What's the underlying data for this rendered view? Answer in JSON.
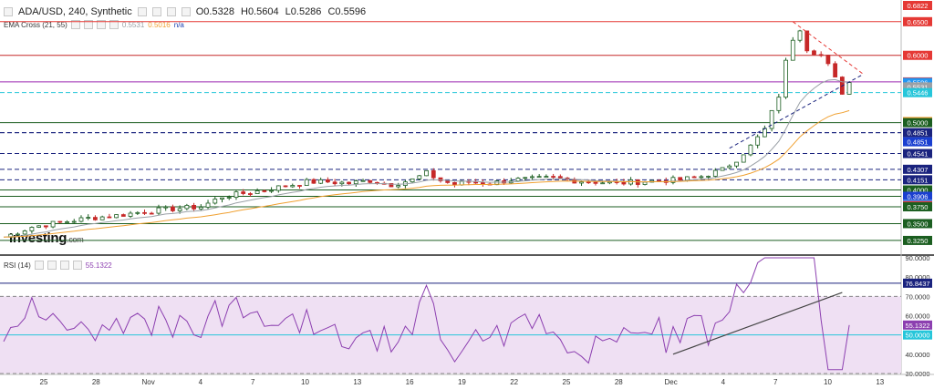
{
  "header": {
    "symbol": "ADA/USD, 240, Synthetic",
    "ohlc": [
      "O0.5328",
      "H0.5604",
      "L0.5286",
      "C0.5596"
    ]
  },
  "indicator": {
    "label": "EMA Cross (21, 55)",
    "value_fast": "0.5531",
    "value_slow": "0.5016",
    "value_na": "n/a"
  },
  "rsi": {
    "label": "RSI (14)",
    "value": "55.1322"
  },
  "logo": {
    "text": "Investing",
    "suffix": ".com"
  },
  "colors": {
    "red_level": "#e53935",
    "purple_level": "#9c27b0",
    "cyan_level": "#26c6da",
    "navy_level": "#1a237e",
    "green_level": "#1b5e20",
    "candle_up": "#1b5e20",
    "candle_down": "#c62828",
    "ema_fast": "#9aa0a6",
    "ema_slow": "#f0a030",
    "rsi_line": "#8c3fb0",
    "rsi_band": "#efe0f3"
  },
  "chart_data": [
    {
      "type": "candlestick",
      "title": "ADA/USD, 240, Synthetic",
      "ylim": [
        0.31,
        0.6822
      ],
      "x_tick_labels": [
        "25",
        "28",
        "Nov",
        "4",
        "7",
        "10",
        "13",
        "16",
        "19",
        "22",
        "25",
        "28",
        "Dec",
        "4",
        "7",
        "10",
        "13"
      ],
      "price_labels": [
        {
          "text": "0.6822",
          "value": 0.6822,
          "color": "#e53935"
        },
        {
          "text": "0.6500",
          "value": 0.65,
          "color": "#e53935"
        },
        {
          "text": "0.6000",
          "value": 0.6,
          "color": "#e53935"
        },
        {
          "text": "0.5605",
          "value": 0.5605,
          "color": "#e53935"
        },
        {
          "text": "0.5596",
          "value": 0.5596,
          "color": "#2196f3"
        },
        {
          "text": "0.5531",
          "value": 0.5531,
          "color": "#9aa0a6"
        },
        {
          "text": "0.5446",
          "value": 0.5446,
          "color": "#26c6da"
        },
        {
          "text": "0.5016",
          "value": 0.5016,
          "color": "#f0a030"
        },
        {
          "text": "0.5000",
          "value": 0.5,
          "color": "#1b5e20"
        },
        {
          "text": "0.4851",
          "value": 0.4851,
          "color": "#1a237e"
        },
        {
          "text": "0.4851",
          "value": 0.4851,
          "color": "#1a3fd0"
        },
        {
          "text": "0.4541",
          "value": 0.4541,
          "color": "#1a237e"
        },
        {
          "text": "0.4307",
          "value": 0.4307,
          "color": "#1a237e"
        },
        {
          "text": "0.4151",
          "value": 0.4151,
          "color": "#1a237e"
        },
        {
          "text": "0.4000",
          "value": 0.4,
          "color": "#1b5e20"
        },
        {
          "text": "0.3906",
          "value": 0.3906,
          "color": "#1a3fd0"
        },
        {
          "text": "0.3792",
          "value": 0.3792,
          "color": "#4a7fe0"
        },
        {
          "text": "0.3765",
          "value": 0.3765,
          "color": "#e53935"
        },
        {
          "text": "0.3750",
          "value": 0.375,
          "color": "#1b5e20"
        },
        {
          "text": "0.3500",
          "value": 0.35,
          "color": "#1b5e20"
        },
        {
          "text": "0.3250",
          "value": 0.325,
          "color": "#1b5e20"
        }
      ],
      "levels": [
        {
          "value": 0.65,
          "color": "#e53935",
          "style": "solid"
        },
        {
          "value": 0.6,
          "color": "#c62828",
          "style": "solid"
        },
        {
          "value": 0.5605,
          "color": "#9c27b0",
          "style": "solid"
        },
        {
          "value": 0.5446,
          "color": "#26c6da",
          "style": "dashed"
        },
        {
          "value": 0.5,
          "color": "#1b5e20",
          "style": "solid"
        },
        {
          "value": 0.4851,
          "color": "#1a237e",
          "style": "dashed"
        },
        {
          "value": 0.4851,
          "color": "#1a237e",
          "style": "dashed"
        },
        {
          "value": 0.4541,
          "color": "#1a237e",
          "style": "dashed"
        },
        {
          "value": 0.4307,
          "color": "#1a237e",
          "style": "dashed"
        },
        {
          "value": 0.4151,
          "color": "#1a237e",
          "style": "dashed"
        },
        {
          "value": 0.4,
          "color": "#1b5e20",
          "style": "solid"
        },
        {
          "value": 0.3906,
          "color": "#1b5e20",
          "style": "solid"
        },
        {
          "value": 0.375,
          "color": "#1b5e20",
          "style": "solid"
        },
        {
          "value": 0.35,
          "color": "#1b5e20",
          "style": "solid"
        },
        {
          "value": 0.325,
          "color": "#1b5e20",
          "style": "solid"
        }
      ],
      "series": [
        {
          "name": "EMA 21",
          "color": "#9aa0a6"
        },
        {
          "name": "EMA 55",
          "color": "#f0a030"
        }
      ],
      "close_path": [
        [
          0,
          0.33
        ],
        [
          4,
          0.345
        ],
        [
          8,
          0.352
        ],
        [
          12,
          0.358
        ],
        [
          16,
          0.362
        ],
        [
          20,
          0.368
        ],
        [
          24,
          0.372
        ],
        [
          28,
          0.375
        ],
        [
          31,
          0.39
        ],
        [
          34,
          0.395
        ],
        [
          37,
          0.4
        ],
        [
          40,
          0.406
        ],
        [
          43,
          0.412
        ],
        [
          46,
          0.412
        ],
        [
          49,
          0.41
        ],
        [
          52,
          0.414
        ],
        [
          55,
          0.408
        ],
        [
          58,
          0.415
        ],
        [
          60,
          0.425
        ],
        [
          62,
          0.414
        ],
        [
          64,
          0.408
        ],
        [
          66,
          0.412
        ],
        [
          69,
          0.41
        ],
        [
          72,
          0.415
        ],
        [
          75,
          0.416
        ],
        [
          78,
          0.418
        ],
        [
          81,
          0.414
        ],
        [
          84,
          0.412
        ],
        [
          87,
          0.41
        ],
        [
          90,
          0.412
        ],
        [
          93,
          0.414
        ],
        [
          96,
          0.415
        ],
        [
          99,
          0.42
        ],
        [
          102,
          0.43
        ],
        [
          104,
          0.445
        ],
        [
          106,
          0.465
        ],
        [
          108,
          0.49
        ],
        [
          110,
          0.54
        ],
        [
          111,
          0.59
        ],
        [
          112,
          0.625
        ],
        [
          113,
          0.64
        ],
        [
          114,
          0.61
        ],
        [
          115,
          0.605
        ],
        [
          116,
          0.6
        ],
        [
          117,
          0.585
        ],
        [
          118,
          0.565
        ],
        [
          119,
          0.545
        ],
        [
          120,
          0.5596
        ]
      ],
      "annotations": {
        "triangle": {
          "apex": [
            122,
            0.572
          ],
          "upper_start": [
            112,
            0.65
          ],
          "lower_start": [
            103,
            0.462
          ]
        }
      }
    },
    {
      "type": "line",
      "title": "RSI (14)",
      "ylim": [
        30,
        90
      ],
      "tick_labels": [
        "90.0000",
        "80.0000",
        "70.0000",
        "60.0000",
        "50.0000",
        "40.0000",
        "30.0000"
      ],
      "tick_values": [
        90,
        80,
        70,
        60,
        50,
        40,
        30
      ],
      "band": [
        30,
        70
      ],
      "reference_lines": [
        {
          "value": 76.8437,
          "label": "76.8437",
          "color": "#1a237e"
        },
        {
          "value": 50.0,
          "label": "50.0000",
          "color": "#26c6da"
        }
      ],
      "last_value": {
        "value": 55.1322,
        "label": "55.1322"
      },
      "trendline": {
        "start": [
          95,
          40
        ],
        "end": [
          119,
          72
        ]
      }
    }
  ]
}
